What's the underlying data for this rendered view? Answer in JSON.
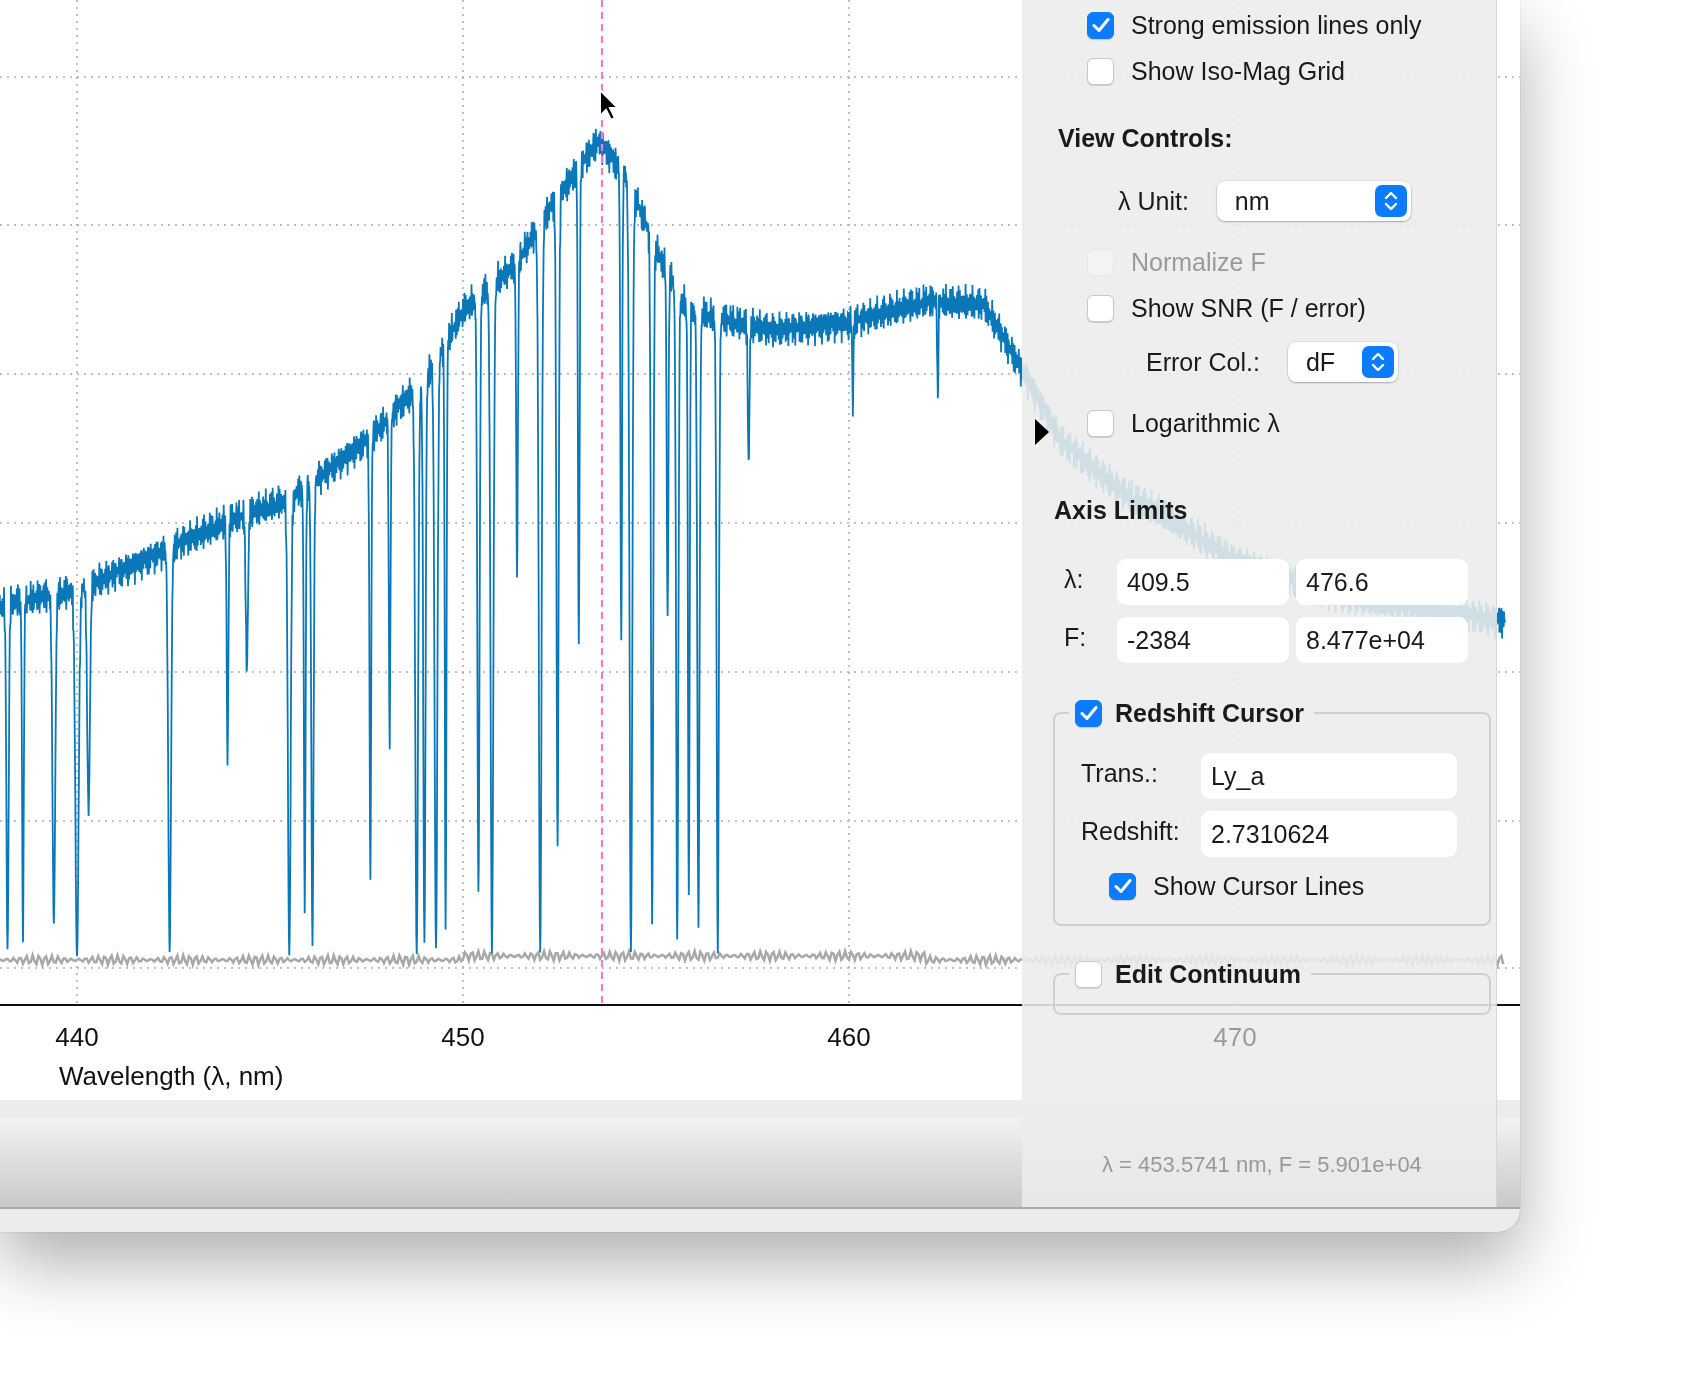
{
  "plot": {
    "x_axis": {
      "ticks": [
        "440",
        "450",
        "460",
        "470"
      ],
      "label": "Wavelength (λ, nm)"
    }
  },
  "panel": {
    "options": [
      {
        "kind": "checkbox",
        "label": "Strong emission lines only",
        "checked": true,
        "disabled": false
      },
      {
        "kind": "checkbox",
        "label": "Show Iso-Mag Grid",
        "checked": false,
        "disabled": false
      }
    ],
    "view_controls": {
      "title": "View Controls:",
      "items": [
        {
          "kind": "select",
          "label": "λ Unit:",
          "value": "nm"
        },
        {
          "kind": "checkbox",
          "label": "Normalize F",
          "checked": false,
          "disabled": true
        },
        {
          "kind": "checkbox",
          "label": "Show SNR (F / error)",
          "checked": false,
          "disabled": false,
          "children": [
            {
              "kind": "select",
              "label": "Error Col.:",
              "value": "dF"
            }
          ]
        },
        {
          "kind": "checkbox",
          "label": "Logarithmic λ",
          "checked": false,
          "disabled": false
        }
      ]
    },
    "axis_limits": {
      "title": "Axis Limits",
      "rows": [
        {
          "label": "λ:",
          "min": "409.5",
          "max": "476.6"
        },
        {
          "label": "F:",
          "min": "-2384",
          "max": "8.477e+04"
        }
      ]
    },
    "redshift_cursor": {
      "label": "Redshift Cursor",
      "checked": true,
      "fields": [
        {
          "label": "Trans.:",
          "value": "Ly_a"
        },
        {
          "label": "Redshift:",
          "value": "2.7310624"
        }
      ],
      "show_cursor_lines": {
        "label": "Show Cursor Lines",
        "checked": true
      }
    },
    "edit_continuum": {
      "label": "Edit Continuum",
      "checked": false
    }
  },
  "status_bar": {
    "text": "λ = 453.5741 nm, F = 5.901e+04"
  }
}
